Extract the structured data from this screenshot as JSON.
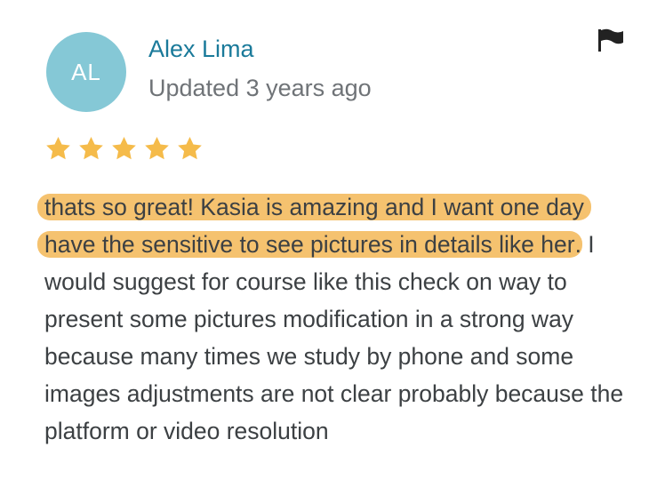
{
  "reviewer": {
    "initials": "AL",
    "name": "Alex Lima",
    "updated": "Updated 3 years ago"
  },
  "rating": {
    "value": 5,
    "max": 5,
    "star_color": "#f5bb4a"
  },
  "review": {
    "highlighted": "thats so great! Kasia is amazing and I want one day have the sensitive to see pictures in details like her",
    "rest": ". I would suggest for course like this check on way to present some pictures modification in a strong way because many times we study by phone and some images adjustments are not clear probably because the platform or video resolution",
    "highlight_color": "#f5c26f"
  },
  "icons": {
    "report": "flag-icon",
    "star": "star-icon"
  },
  "colors": {
    "avatar_bg": "#85c8d6",
    "name": "#1a7a9a",
    "meta": "#6f7377",
    "text": "#3c4043"
  }
}
